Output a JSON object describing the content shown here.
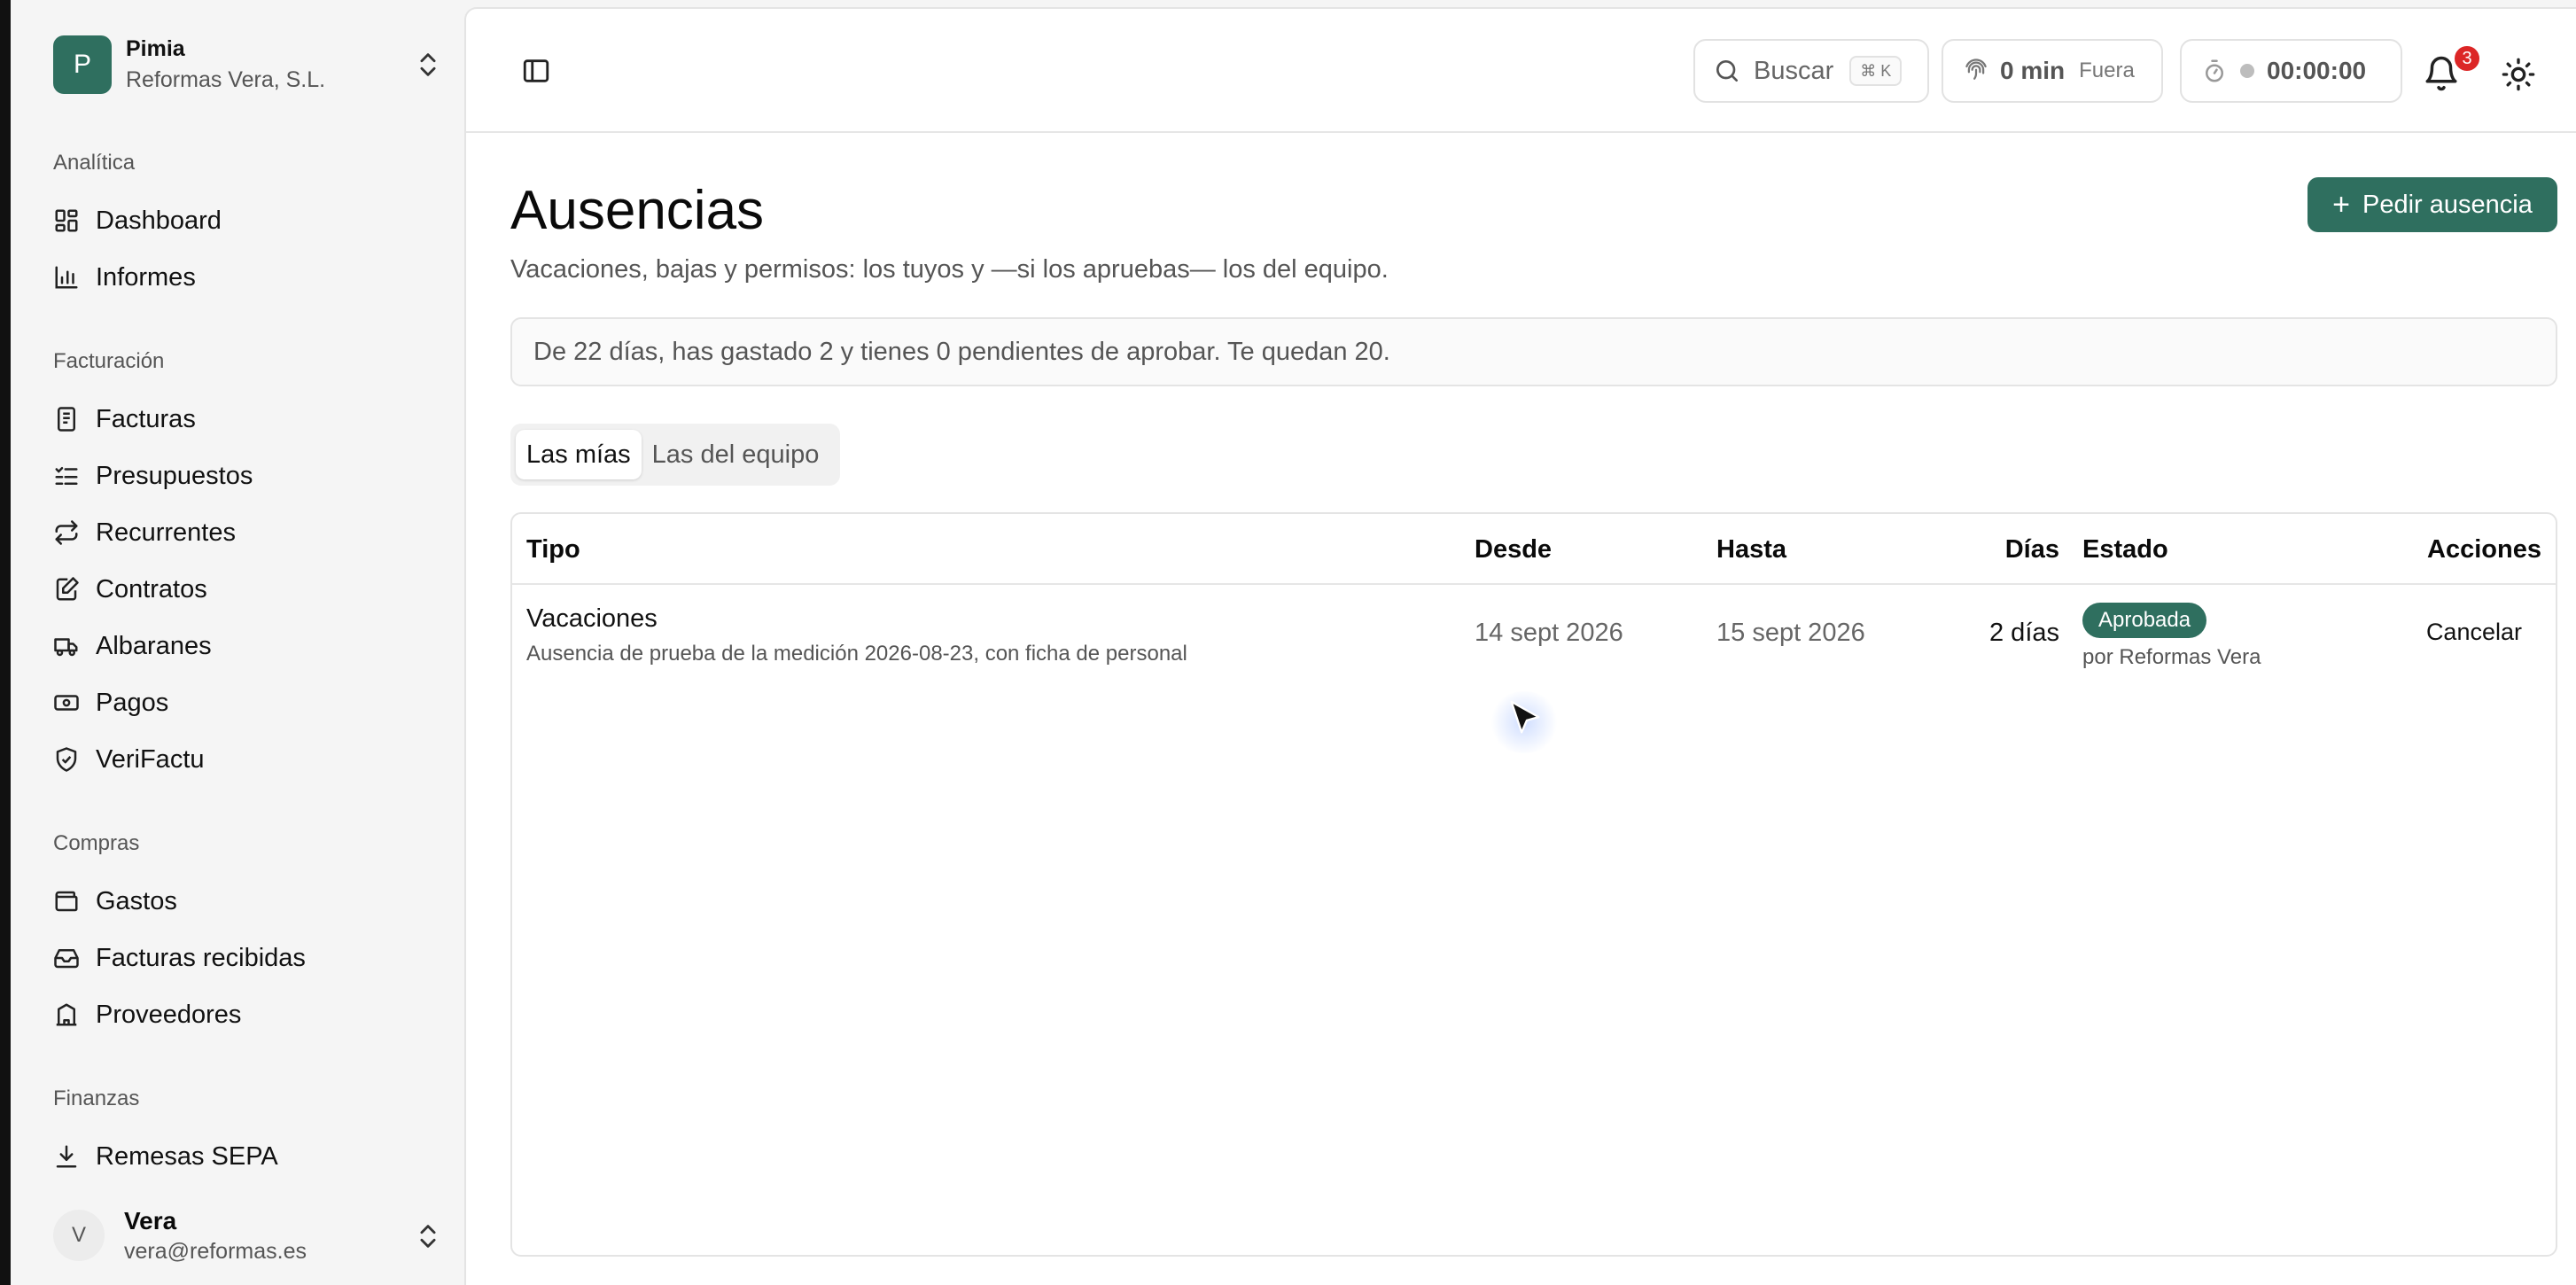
{
  "org": {
    "logo_letter": "P",
    "name": "Pimia",
    "company": "Reformas Vera, S.L."
  },
  "sidebar": {
    "sections": [
      {
        "label": "Analítica",
        "items": [
          {
            "label": "Dashboard",
            "icon": "dashboard-icon"
          },
          {
            "label": "Informes",
            "icon": "bar-chart-icon"
          }
        ]
      },
      {
        "label": "Facturación",
        "items": [
          {
            "label": "Facturas",
            "icon": "receipt-icon"
          },
          {
            "label": "Presupuestos",
            "icon": "list-check-icon"
          },
          {
            "label": "Recurrentes",
            "icon": "repeat-icon"
          },
          {
            "label": "Contratos",
            "icon": "edit-document-icon"
          },
          {
            "label": "Albaranes",
            "icon": "truck-icon"
          },
          {
            "label": "Pagos",
            "icon": "banknote-icon"
          },
          {
            "label": "VeriFactu",
            "icon": "shield-check-icon"
          }
        ]
      },
      {
        "label": "Compras",
        "items": [
          {
            "label": "Gastos",
            "icon": "wallet-icon"
          },
          {
            "label": "Facturas recibidas",
            "icon": "inbox-icon"
          },
          {
            "label": "Proveedores",
            "icon": "building-icon"
          }
        ]
      },
      {
        "label": "Finanzas",
        "items": [
          {
            "label": "Remesas SEPA",
            "icon": "download-icon"
          }
        ]
      }
    ]
  },
  "user": {
    "initial": "V",
    "name": "Vera",
    "email": "vera@reformas.es"
  },
  "topbar": {
    "search_label": "Buscar",
    "search_shortcut": "⌘ K",
    "clockin_value": "0 min",
    "clockin_status": "Fuera",
    "timer_value": "00:00:00",
    "notifications_count": "3"
  },
  "page": {
    "title": "Ausencias",
    "subtitle": "Vacaciones, bajas y permisos: los tuyos y —si los apruebas— los del equipo.",
    "primary_action": "Pedir ausencia",
    "summary": "De 22 días, has gastado 2 y tienes 0 pendientes de aprobar. Te quedan 20.",
    "tabs": [
      "Las mías",
      "Las del equipo"
    ],
    "active_tab": "Las mías"
  },
  "table": {
    "columns": [
      "Tipo",
      "Desde",
      "Hasta",
      "Días",
      "Estado",
      "Acciones"
    ],
    "rows": [
      {
        "type": "Vacaciones",
        "description": "Ausencia de prueba de la medición 2026-08-23, con ficha de personal",
        "from": "14 sept 2026",
        "to": "15 sept 2026",
        "days": "2 días",
        "status": "Aprobada",
        "status_by": "por Reformas Vera",
        "action": "Cancelar"
      }
    ]
  },
  "colors": {
    "brand": "#2f6f5f",
    "danger": "#dc2626"
  }
}
